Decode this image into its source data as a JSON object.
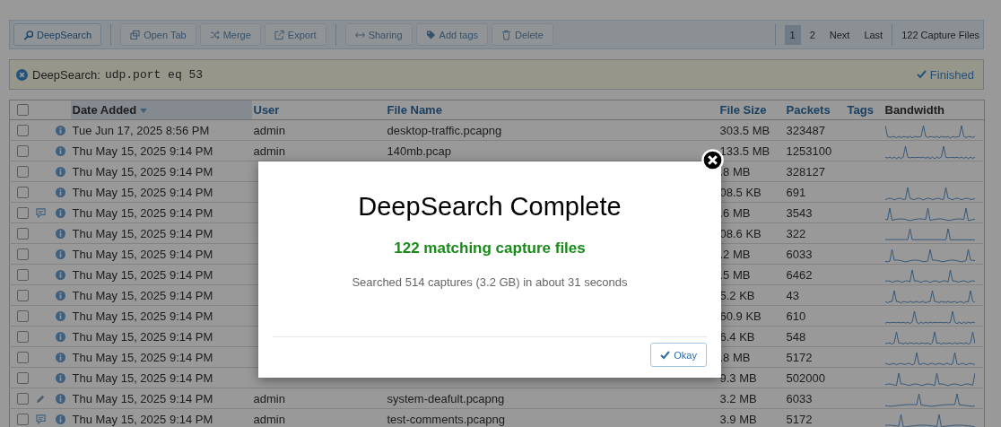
{
  "toolbar": {
    "groups": [
      [
        {
          "label": "DeepSearch",
          "disabled": false
        }
      ],
      [
        {
          "label": "Open Tab",
          "disabled": true
        },
        {
          "label": "Merge",
          "disabled": true
        },
        {
          "label": "Export",
          "disabled": true
        }
      ],
      [
        {
          "label": "Sharing",
          "disabled": true
        },
        {
          "label": "Add tags",
          "disabled": true
        },
        {
          "label": "Delete",
          "disabled": true
        }
      ]
    ],
    "pages": [
      {
        "label": "1",
        "selected": true
      },
      {
        "label": "2",
        "selected": false
      }
    ],
    "nav": [
      "Next",
      "Last"
    ],
    "count": "122 Capture Files"
  },
  "search_bar": {
    "label": "DeepSearch:",
    "query": "udp.port eq 53",
    "status": "Finished"
  },
  "table": {
    "columns": [
      {
        "label": "Date Added",
        "sortable": true,
        "sorted": true
      },
      {
        "label": "User",
        "sortable": true,
        "sorted": false
      },
      {
        "label": "File Name",
        "sortable": true,
        "sorted": false
      },
      {
        "label": "File Size",
        "sortable": true,
        "sorted": false
      },
      {
        "label": "Packets",
        "sortable": true,
        "sorted": false
      },
      {
        "label": "Tags",
        "sortable": true,
        "sorted": false
      },
      {
        "label": "Bandwidth",
        "sortable": false,
        "sorted": false
      }
    ],
    "select_all": false,
    "rows": [
      {
        "checked": false,
        "date": "Tue Jun 17, 2025 8:56 PM",
        "user": "admin",
        "file": "desktop-traffic.pcapng",
        "size": "303.5 MB",
        "packets": "323487",
        "sparkline": true
      },
      {
        "checked": false,
        "date": "Thu May 15, 2025 9:14 PM",
        "user": "admin",
        "file": "140mb.pcap",
        "size": "133.5 MB",
        "packets": "1253100",
        "sparkline": true
      },
      {
        "checked": false,
        "date": "Thu May 15, 2025 9:14 PM",
        "size": ".8 MB",
        "packets": "328127",
        "sparkline": false
      },
      {
        "checked": false,
        "date": "Thu May 15, 2025 9:14 PM",
        "size": "08.5 KB",
        "packets": "691",
        "sparkline": true
      },
      {
        "checked": false,
        "kind": "comment",
        "date": "Thu May 15, 2025 9:14 PM",
        "size": ".6 MB",
        "packets": "3543",
        "sparkline": true
      },
      {
        "checked": false,
        "date": "Thu May 15, 2025 9:14 PM",
        "size": "08.6 KB",
        "packets": "322",
        "sparkline": true
      },
      {
        "checked": false,
        "date": "Thu May 15, 2025 9:14 PM",
        "size": ".2 MB",
        "packets": "6033",
        "sparkline": true
      },
      {
        "checked": false,
        "date": "Thu May 15, 2025 9:14 PM",
        "size": ".5 MB",
        "packets": "6462",
        "sparkline": true
      },
      {
        "checked": false,
        "date": "Thu May 15, 2025 9:14 PM",
        "size": "5.2 KB",
        "packets": "43",
        "sparkline": true
      },
      {
        "checked": false,
        "date": "Thu May 15, 2025 9:14 PM",
        "size": "60.9 KB",
        "packets": "610",
        "sparkline": true
      },
      {
        "checked": false,
        "date": "Thu May 15, 2025 9:14 PM",
        "size": "6.4 KB",
        "packets": "548",
        "sparkline": true
      },
      {
        "checked": false,
        "date": "Thu May 15, 2025 9:14 PM",
        "size": ".8 MB",
        "packets": "5172",
        "sparkline": true
      },
      {
        "checked": false,
        "date": "Thu May 15, 2025 9:14 PM",
        "size": "9.3 MB",
        "packets": "502000",
        "sparkline": true
      },
      {
        "checked": false,
        "kind": "edit",
        "date": "Thu May 15, 2025 9:14 PM",
        "user": "admin",
        "file": "system-deafult.pcapng",
        "size": "3.2 MB",
        "packets": "6033",
        "sparkline": true
      },
      {
        "checked": false,
        "kind": "comment",
        "date": "Thu May 15, 2025 9:14 PM",
        "user": "admin",
        "file": "test-comments.pcapng",
        "size": "3.9 MB",
        "packets": "5172",
        "sparkline": true
      }
    ]
  },
  "modal": {
    "title": "DeepSearch Complete",
    "result": "122 matching capture files",
    "detail": "Searched 514 captures (3.2 GB) in about 31 seconds",
    "button": "Okay"
  }
}
